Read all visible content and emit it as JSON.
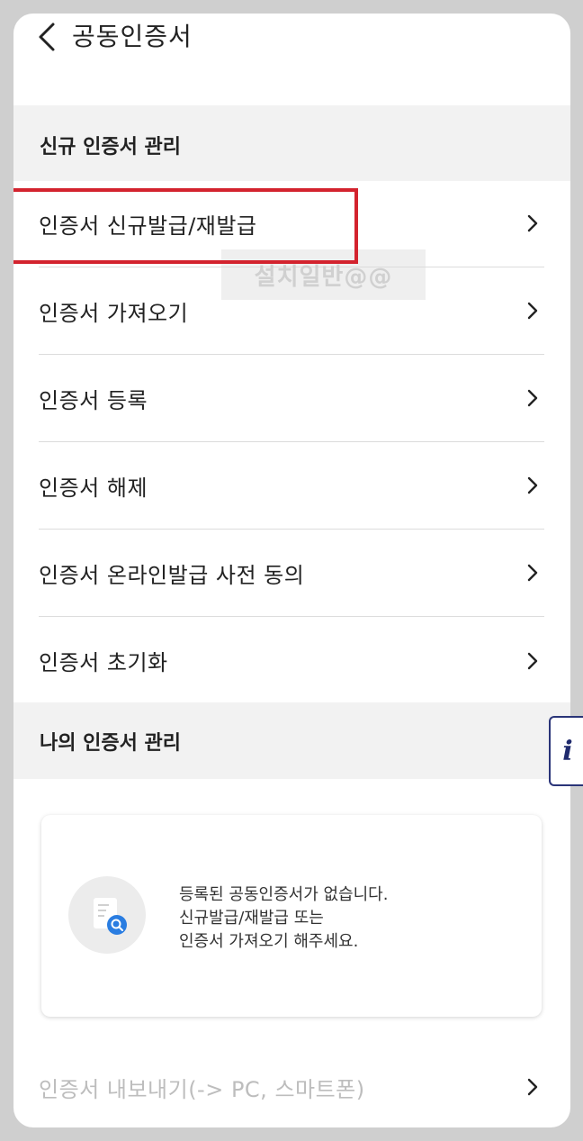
{
  "header": {
    "title": "공동인증서",
    "back_icon": "chevron-left-icon"
  },
  "sections": {
    "new_cert": {
      "title": "신규 인증서 관리"
    },
    "my_cert": {
      "title": "나의 인증서 관리"
    }
  },
  "menu": [
    {
      "label": "인증서 신규발급/재발급"
    },
    {
      "label": "인증서 가져오기"
    },
    {
      "label": "인증서 등록"
    },
    {
      "label": "인증서 해제"
    },
    {
      "label": "인증서 온라인발급 사전 동의"
    },
    {
      "label": "인증서 초기화"
    }
  ],
  "empty_state": {
    "line1": "등록된 공동인증서가 없습니다.",
    "line2": "신규발급/재발급 또는",
    "line3": "인증서 가져오기 해주세요.",
    "icon": "document-search-icon"
  },
  "export_item": {
    "label": "인증서 내보내기(-> PC, 스마트폰)"
  },
  "watermark": {
    "text": "설치일반@@"
  },
  "info_button": {
    "text": "i"
  },
  "colors": {
    "highlight": "#d3232e",
    "accent": "#1f2a6d",
    "search_badge": "#2a7de1"
  }
}
